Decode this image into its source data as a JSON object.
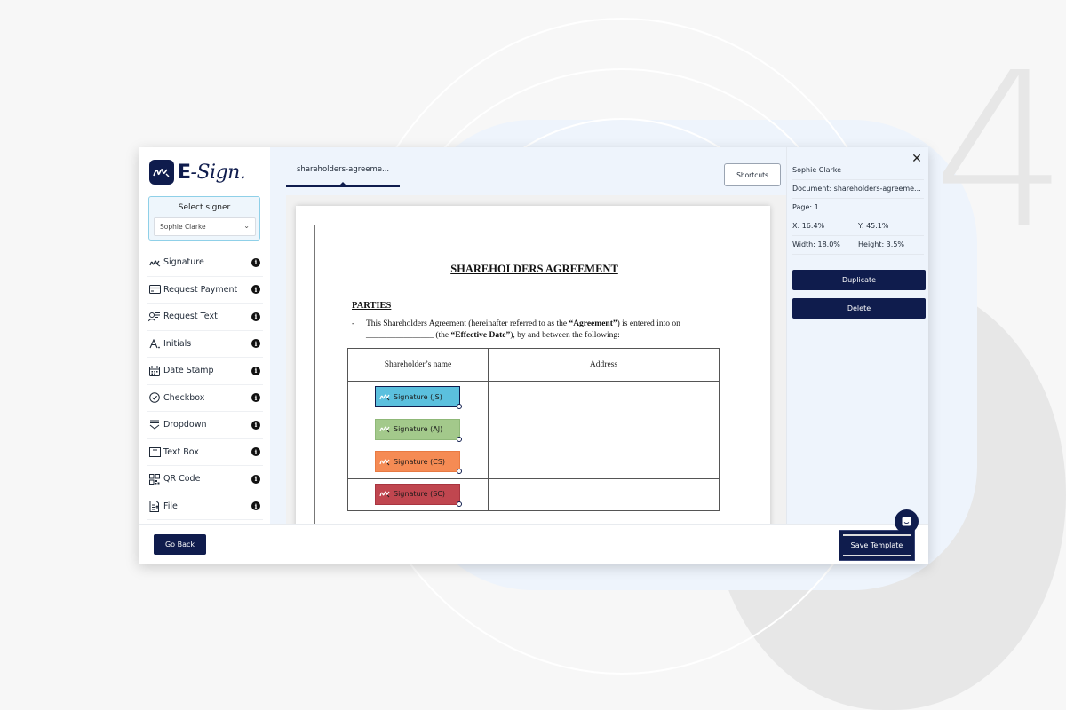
{
  "background": {
    "step_number": "4"
  },
  "app": {
    "logo_text_prefix": "E",
    "logo_text_suffix": "-Sign."
  },
  "signer": {
    "label": "Select signer",
    "selected": "Sophie Clarke"
  },
  "tools": [
    {
      "label": "Signature",
      "icon": "signature-icon"
    },
    {
      "label": "Request Payment",
      "icon": "credit-card-icon"
    },
    {
      "label": "Request Text",
      "icon": "user-text-icon"
    },
    {
      "label": "Initials",
      "icon": "initials-icon"
    },
    {
      "label": "Date Stamp",
      "icon": "calendar-icon"
    },
    {
      "label": "Checkbox",
      "icon": "check-circle-icon"
    },
    {
      "label": "Dropdown",
      "icon": "dropdown-icon"
    },
    {
      "label": "Text Box",
      "icon": "text-box-icon"
    },
    {
      "label": "QR Code",
      "icon": "qr-code-icon"
    },
    {
      "label": "File",
      "icon": "file-icon"
    }
  ],
  "tab": {
    "label": "shareholders-agreeme..."
  },
  "toolbar": {
    "shortcuts_label": "Shortcuts"
  },
  "document": {
    "title": "SHAREHOLDERS AGREEMENT",
    "section_heading": "PARTIES",
    "para_dash": "-",
    "para_part1": "This Shareholders Agreement (hereinafter referred to as the ",
    "para_bold1": "“Agreement”",
    "para_part2": ") is entered into on ________________ (the ",
    "para_bold2": "“Effective Date”",
    "para_part3": "), by and between the following:",
    "table_headers": [
      "Shareholder’s name",
      "Address"
    ],
    "signature_fields": [
      {
        "label": "Signature (JS)",
        "color": "#5bc0de",
        "border": "#0f1c4d"
      },
      {
        "label": "Signature (AJ)",
        "color": "#a3c98b",
        "border": "#8fb878"
      },
      {
        "label": "Signature (CS)",
        "color": "#f58b54",
        "border": "#e87a42"
      },
      {
        "label": "Signature (SC)",
        "color": "#c0464f",
        "border": "#a83540"
      }
    ]
  },
  "details": {
    "signer_name": "Sophie Clarke",
    "document": "Document: shareholders-agreeme...",
    "page": "Page: 1",
    "x": "X: 16.4%",
    "y": "Y: 45.1%",
    "width": "Width: 18.0%",
    "height": "Height: 3.5%",
    "duplicate_label": "Duplicate",
    "delete_label": "Delete"
  },
  "footer": {
    "go_back_label": "Go Back",
    "save_template_label": "Save Template"
  }
}
